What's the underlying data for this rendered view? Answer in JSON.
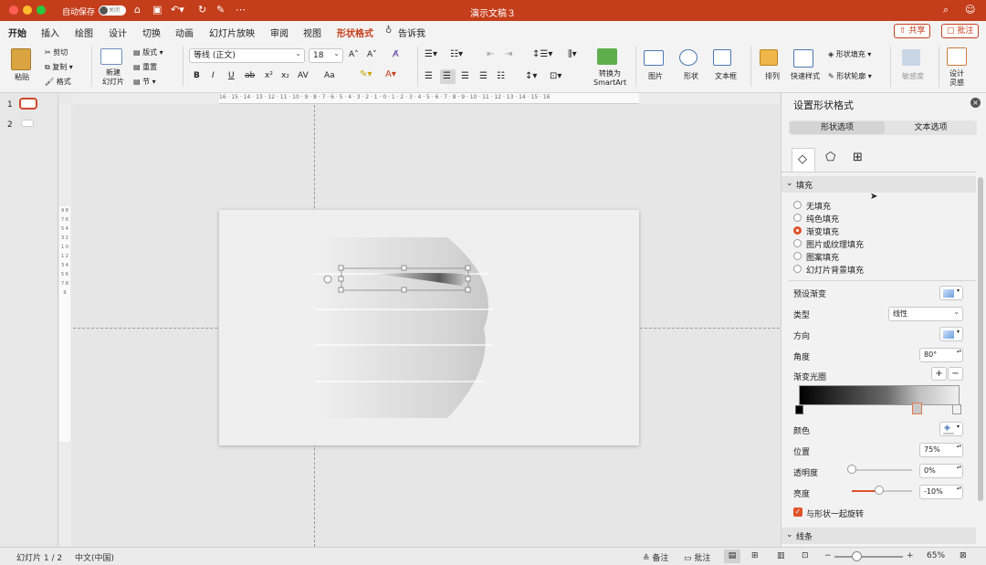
{
  "titlebar": {
    "autosave_label": "自动保存",
    "autosave_state": "关闭",
    "doc_title": "演示文稿３"
  },
  "tabs": [
    "开始",
    "插入",
    "绘图",
    "设计",
    "切换",
    "动画",
    "幻灯片放映",
    "审阅",
    "视图",
    "形状格式",
    "告诉我"
  ],
  "share": {
    "share_label": "共享",
    "comment_label": "批注"
  },
  "ribbon": {
    "paste": "粘贴",
    "cut": "剪切",
    "copy": "复制",
    "format": "格式",
    "new_slide": "新建\n幻灯片",
    "layout": "版式",
    "reset": "重置",
    "section": "节",
    "font_name": "等线 (正文)",
    "font_size": "18",
    "bold": "B",
    "italic": "I",
    "underline": "U",
    "strike": "ab",
    "superscript": "x²",
    "subscript": "x₂",
    "spacing": "AV",
    "case": "Aa",
    "smartart": "转换为\nSmartArt",
    "picture": "图片",
    "shape": "形状",
    "textbox": "文本框",
    "arrange": "排列",
    "quick_styles": "快速样式",
    "shape_fill": "形状填充",
    "shape_outline": "形状轮廓",
    "sensitivity": "敏感度",
    "designer": "设计\n灵感"
  },
  "slides": [
    {
      "number": "1"
    },
    {
      "number": "2"
    }
  ],
  "ruler": {
    "h_ticks": "16 · 15 · 14 · 13 · 12 · 11 · 10 · 9 · 8 · 7 · 6 · 5 · 4 · 3 · 2 · 1 · 0 · 1 · 2 · 3 · 4 · 5 · 6 · 7 · 8 · 9 · 10 · 11 · 12 · 13 · 14 · 15 · 16",
    "v_ticks": "9 8 7 6 5 4 3 2 1 0 1 2 3 4 5 6 7 8 9"
  },
  "panel": {
    "title": "设置形状格式",
    "tab_shape": "形状选项",
    "tab_text": "文本选项",
    "fill_section": "填充",
    "fill_options": [
      {
        "label": "无填充",
        "selected": false
      },
      {
        "label": "纯色填充",
        "selected": false
      },
      {
        "label": "渐变填充",
        "selected": true
      },
      {
        "label": "图片或纹理填充",
        "selected": false
      },
      {
        "label": "图案填充",
        "selected": false
      },
      {
        "label": "幻灯片背景填充",
        "selected": false
      }
    ],
    "preset_label": "预设渐变",
    "type_label": "类型",
    "type_value": "线性",
    "direction_label": "方向",
    "angle_label": "角度",
    "angle_value": "80°",
    "stops_label": "渐变光圈",
    "color_label": "颜色",
    "position_label": "位置",
    "position_value": "75%",
    "transparency_label": "透明度",
    "transparency_value": "0%",
    "transparency_level": 0,
    "brightness_label": "亮度",
    "brightness_value": "-10%",
    "brightness_level": -0.1,
    "rotate_label": "与形状一起旋转",
    "rotate_checked": true,
    "line_section": "线条"
  },
  "status": {
    "slide_info": "幻灯片 1 / 2",
    "language": "中文(中国)",
    "notes": "备注",
    "comments": "批注",
    "zoom": "65%"
  },
  "colors": {
    "accent": "#c43e1c",
    "radio_on": "#e0532b",
    "gradient_stop_active": "#e07a4f"
  }
}
